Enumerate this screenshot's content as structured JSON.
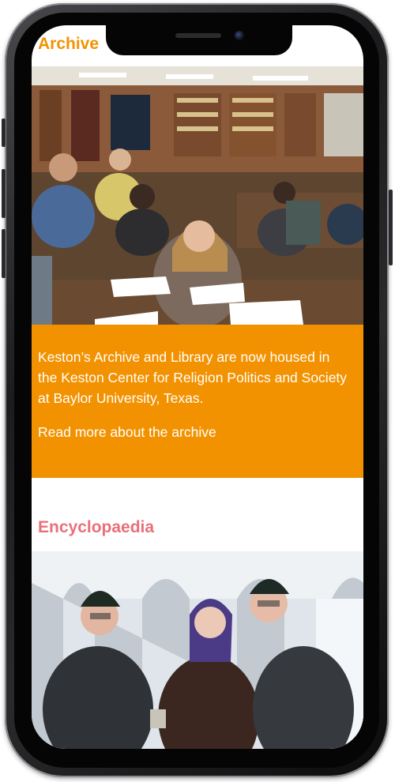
{
  "archive": {
    "heading": "Archive",
    "image_description_alt": "Students studying at tables in the archive reading room",
    "body": "Keston’s Archive and Library are now housed in the Keston Center for Religion Politics and Society at Baylor University, Texas.",
    "link": "Read more about the archive"
  },
  "encyclopaedia": {
    "heading": "Encyclopaedia",
    "image_description_alt": "Three people in winter clothing standing in front of arches in snow"
  },
  "colors": {
    "accent_orange": "#f39200",
    "heading_pink": "#e8707a",
    "text_on_orange": "#ffffff",
    "phone_frame": "#1c1c1e"
  }
}
